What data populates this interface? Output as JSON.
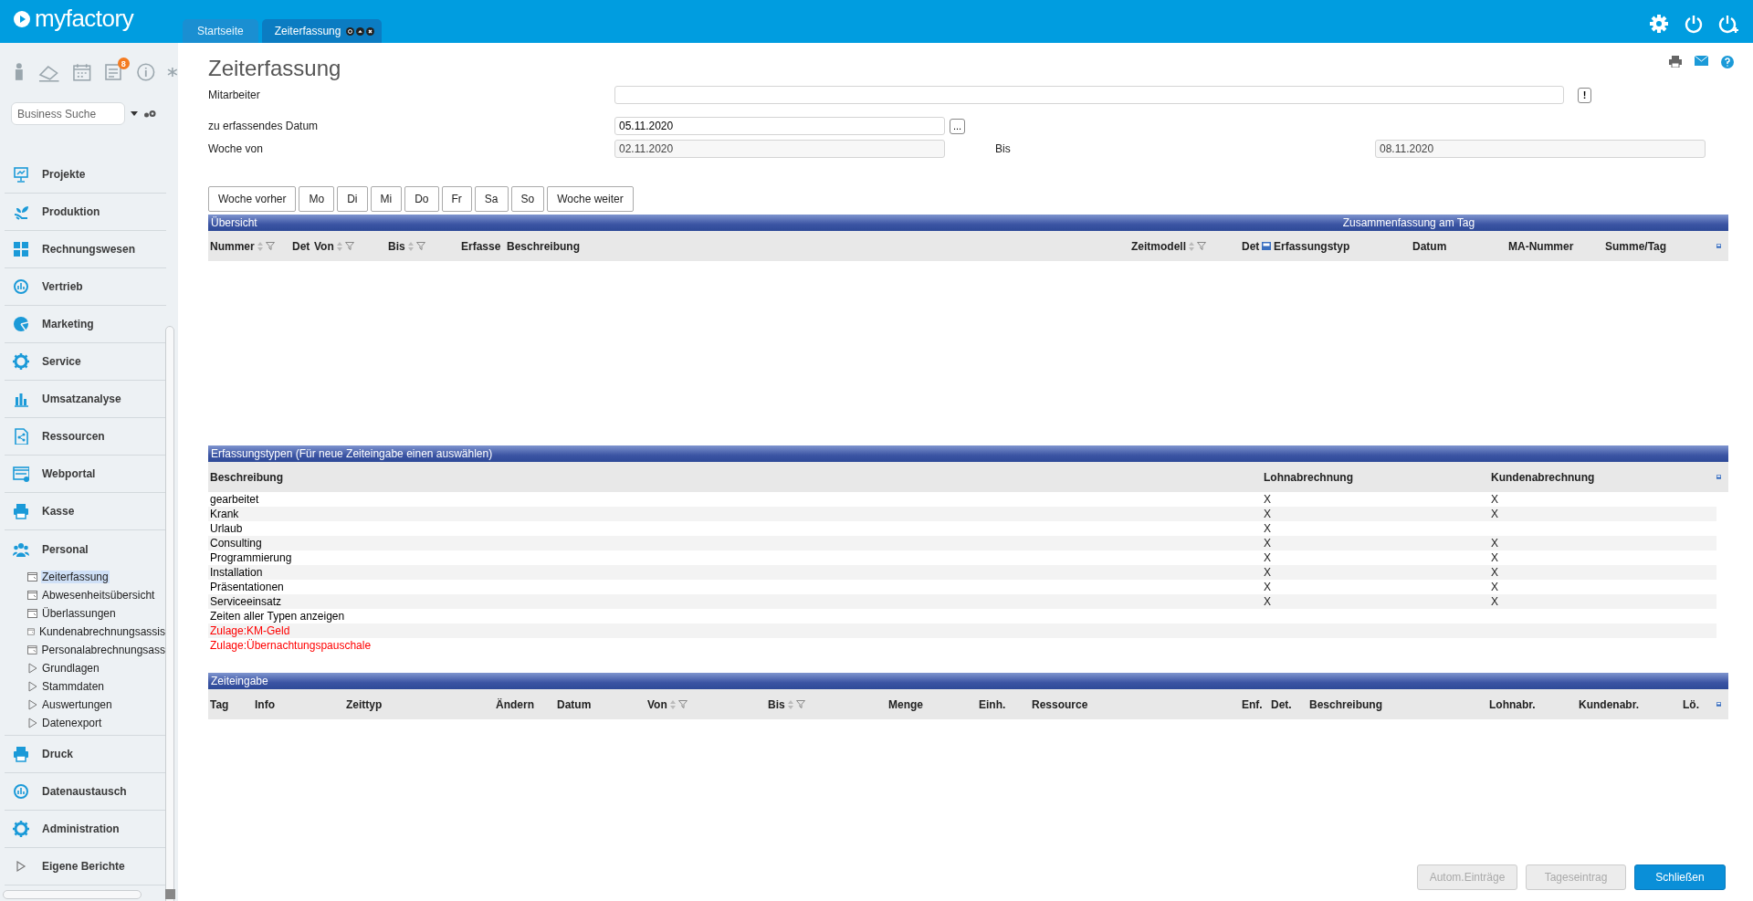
{
  "app": {
    "logo": "myfactory"
  },
  "tabs": [
    {
      "label": "Startseite",
      "selected": false
    },
    {
      "label": "Zeiterfassung",
      "selected": true
    }
  ],
  "sidebar": {
    "notification_count": "8",
    "search": {
      "placeholder": "Business Suche"
    },
    "items": [
      {
        "label": "Projekte",
        "expanded": false
      },
      {
        "label": "Produktion",
        "expanded": false
      },
      {
        "label": "Rechnungswesen",
        "expanded": false
      },
      {
        "label": "Vertrieb",
        "expanded": false
      },
      {
        "label": "Marketing",
        "expanded": false
      },
      {
        "label": "Service",
        "expanded": false
      },
      {
        "label": "Umsatzanalyse",
        "expanded": false
      },
      {
        "label": "Ressourcen",
        "expanded": false
      },
      {
        "label": "Webportal",
        "expanded": false
      },
      {
        "label": "Kasse",
        "expanded": false
      },
      {
        "label": "Personal",
        "expanded": true,
        "children": [
          {
            "label": "Zeiterfassung",
            "kind": "page",
            "selected": true
          },
          {
            "label": "Abwesenheitsübersicht",
            "kind": "page",
            "selected": false
          },
          {
            "label": "Überlassungen",
            "kind": "page",
            "selected": false
          },
          {
            "label": "Kundenabrechnungsassis",
            "kind": "page",
            "selected": false
          },
          {
            "label": "Personalabrechnungsass",
            "kind": "page",
            "selected": false
          },
          {
            "label": "Grundlagen",
            "kind": "folder",
            "selected": false
          },
          {
            "label": "Stammdaten",
            "kind": "folder",
            "selected": false
          },
          {
            "label": "Auswertungen",
            "kind": "folder",
            "selected": false
          },
          {
            "label": "Datenexport",
            "kind": "folder",
            "selected": false
          }
        ]
      },
      {
        "label": "Druck",
        "expanded": false
      },
      {
        "label": "Datenaustausch",
        "expanded": false
      },
      {
        "label": "Administration",
        "expanded": false
      },
      {
        "label": "Eigene Berichte",
        "expanded": false,
        "kind": "folder"
      }
    ]
  },
  "page": {
    "title": "Zeiterfassung"
  },
  "form": {
    "employee": {
      "label": "Mitarbeiter",
      "button": "!"
    },
    "date": {
      "label": "zu erfassendes Datum",
      "value": "05.11.2020",
      "button": "..."
    },
    "week_from": {
      "label": "Woche von",
      "value": "02.11.2020"
    },
    "week_to": {
      "label": "Bis",
      "value": "08.11.2020"
    }
  },
  "day_buttons": [
    "Woche vorher",
    "Mo",
    "Di",
    "Mi",
    "Do",
    "Fr",
    "Sa",
    "So",
    "Woche weiter"
  ],
  "overview": {
    "title": "Übersicht",
    "summary_title": "Zusammenfassung am Tag",
    "columns": [
      {
        "label": "Nummer",
        "filter": true
      },
      {
        "label": "Det",
        "filter": false
      },
      {
        "label": "Von",
        "filter": true
      },
      {
        "label": "Bis",
        "filter": true
      },
      {
        "label": "Erfasse",
        "filter": false
      },
      {
        "label": "Beschreibung",
        "filter": false
      },
      {
        "label": "Zeitmodell",
        "filter": true
      },
      {
        "label": "Det",
        "filter": false,
        "has_icon": true
      },
      {
        "label": "Erfassungstyp",
        "filter": false
      },
      {
        "label": "Datum",
        "filter": false
      },
      {
        "label": "MA-Nummer",
        "filter": false
      },
      {
        "label": "Summe/Tag",
        "filter": false
      }
    ]
  },
  "types": {
    "title": "Erfassungstypen (Für neue Zeiteingabe einen auswählen)",
    "columns": [
      "Beschreibung",
      "Lohnabrechnung",
      "Kundenabrechnung"
    ],
    "rows": [
      {
        "description": "gearbeitet",
        "payroll": "X",
        "billing": "X",
        "color": "#000000"
      },
      {
        "description": "Krank",
        "payroll": "X",
        "billing": "X",
        "color": "#000000"
      },
      {
        "description": "Urlaub",
        "payroll": "X",
        "color": "#000000"
      },
      {
        "description": "Consulting",
        "payroll": "X",
        "billing": "X",
        "color": "#000000"
      },
      {
        "description": "Programmierung",
        "payroll": "X",
        "billing": "X",
        "color": "#000000"
      },
      {
        "description": "Installation",
        "payroll": "X",
        "billing": "X",
        "color": "#000000"
      },
      {
        "description": "Präsentationen",
        "payroll": "X",
        "billing": "X",
        "color": "#000000"
      },
      {
        "description": "Serviceeinsatz",
        "payroll": "X",
        "billing": "X",
        "color": "#000000"
      },
      {
        "description": "Zeiten aller Typen anzeigen",
        "color": "#000000"
      },
      {
        "description": "Zulage:KM-Geld",
        "color": "#ff0000"
      },
      {
        "description": "Zulage:Übernachtungspauschale",
        "color": "#ff0000"
      }
    ]
  },
  "entry": {
    "title": "Zeiteingabe",
    "columns": [
      {
        "label": "Tag",
        "filter": false
      },
      {
        "label": "Info",
        "filter": false
      },
      {
        "label": "Zeittyp",
        "filter": false
      },
      {
        "label": "Ändern",
        "filter": false
      },
      {
        "label": "Datum",
        "filter": false
      },
      {
        "label": "Von",
        "filter": true
      },
      {
        "label": "Bis",
        "filter": true
      },
      {
        "label": "Menge",
        "filter": false
      },
      {
        "label": "Einh.",
        "filter": false
      },
      {
        "label": "Ressource",
        "filter": false
      },
      {
        "label": "Enf.",
        "filter": false
      },
      {
        "label": "Det.",
        "filter": false
      },
      {
        "label": "Beschreibung",
        "filter": false
      },
      {
        "label": "Lohnabr.",
        "filter": false
      },
      {
        "label": "Kundenabr.",
        "filter": false
      },
      {
        "label": "Lö.",
        "filter": false
      }
    ]
  },
  "footer_buttons": [
    {
      "label": "Autom.Einträge",
      "disabled": true
    },
    {
      "label": "Tageseintrag",
      "disabled": true
    },
    {
      "label": "Schließen",
      "disabled": false
    }
  ]
}
